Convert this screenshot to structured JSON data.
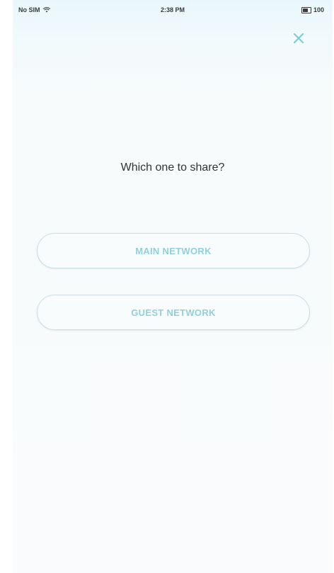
{
  "status_bar": {
    "carrier": "No SIM",
    "time": "2:38 PM",
    "battery": "100"
  },
  "dialog": {
    "title": "Which one to share?",
    "options": [
      {
        "label": "MAIN NETWORK"
      },
      {
        "label": "GUEST NETWORK"
      }
    ]
  },
  "colors": {
    "accent": "#8fd0dc",
    "close_icon": "#7fcbd6",
    "button_border": "#c9dde2"
  },
  "icons": [
    "wifi-icon",
    "battery-icon",
    "close-icon"
  ]
}
